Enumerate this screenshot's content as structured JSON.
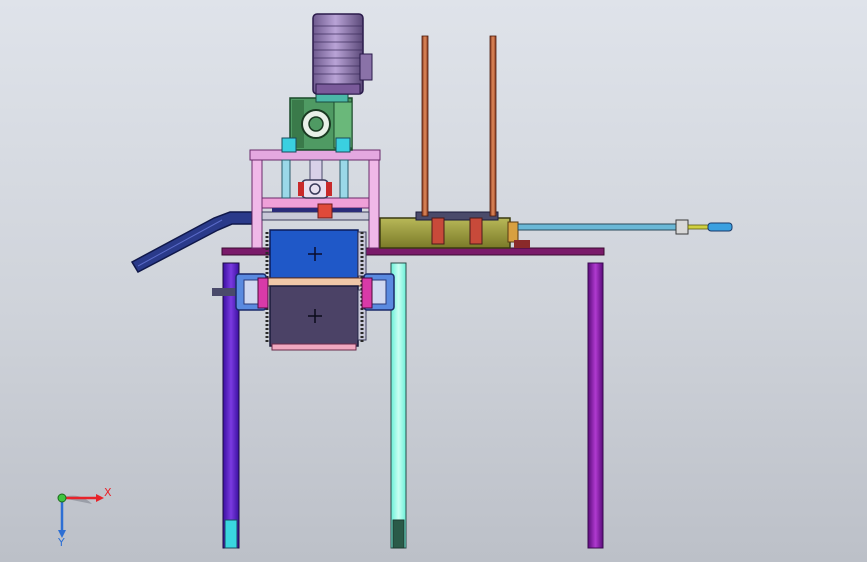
{
  "view": {
    "background_top": "#dfe3ea",
    "background_bottom": "#bcc0c8"
  },
  "triad": {
    "x_label": "X",
    "y_label": "Y",
    "x_color": "#e8232a",
    "y_color": "#2d6fd4",
    "origin_color": "#3fc43f"
  },
  "colors": {
    "motor_body": "#9a7fb8",
    "gearbox": "#4f9a63",
    "frame_pink": "#e8a6d8",
    "frame_purple": "#7a2a80",
    "block_blue": "#1f58c8",
    "block_dark": "#4b4266",
    "base_olive": "#9a9a3a",
    "copper_rod": "#b85a3a",
    "leg_purple": "#6a2cc0",
    "leg_cyan": "#3ad6e0",
    "leg_teal": "#5ad4c0",
    "leg_magenta": "#8a1a9a",
    "chute_blue": "#2a3a8a",
    "cylinder_cyan": "#6ab8d6"
  }
}
